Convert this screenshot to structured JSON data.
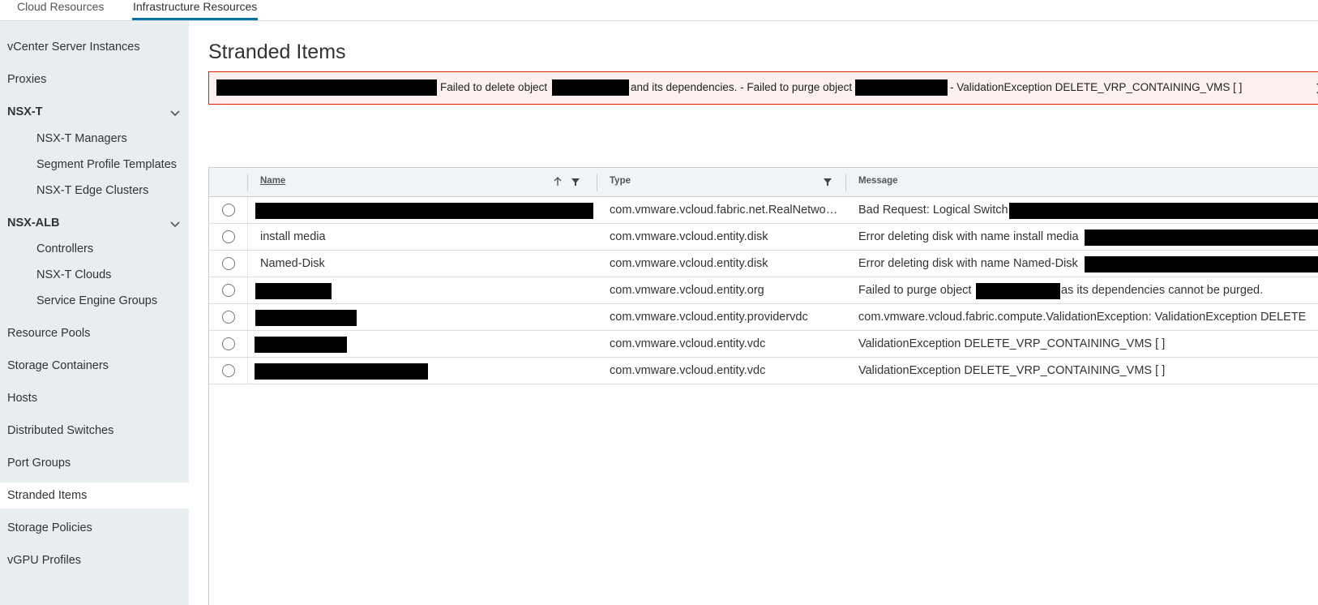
{
  "tabs": [
    {
      "label": "Cloud Resources"
    },
    {
      "label": "Infrastructure Resources"
    }
  ],
  "sidebar": {
    "items": [
      {
        "label": "vCenter Server Instances"
      },
      {
        "label": "Proxies"
      },
      {
        "label": "NSX-T"
      },
      {
        "label": "NSX-T Managers"
      },
      {
        "label": "Segment Profile Templates"
      },
      {
        "label": "NSX-T Edge Clusters"
      },
      {
        "label": "NSX-ALB"
      },
      {
        "label": "Controllers"
      },
      {
        "label": "NSX-T Clouds"
      },
      {
        "label": "Service Engine Groups"
      },
      {
        "label": "Resource Pools"
      },
      {
        "label": "Storage Containers"
      },
      {
        "label": "Hosts"
      },
      {
        "label": "Distributed Switches"
      },
      {
        "label": "Port Groups"
      },
      {
        "label": "Stranded Items"
      },
      {
        "label": "Storage Policies"
      },
      {
        "label": "vGPU Profiles"
      }
    ],
    "active": "Stranded Items"
  },
  "page": {
    "title": "Stranded Items"
  },
  "alert": {
    "part1": "Failed to delete object",
    "part2": "and its dependencies. - Failed to purge object",
    "part3": "- ValidationException DELETE_VRP_CONTAINING_VMS [ ]"
  },
  "grid": {
    "columns": {
      "name": "Name",
      "type": "Type",
      "message": "Message"
    },
    "rows": [
      {
        "name": "",
        "type": "com.vmware.vcloud.fabric.net.RealNetworkPool",
        "message": "Bad Request: Logical Switch"
      },
      {
        "name": "install media",
        "type": "com.vmware.vcloud.entity.disk",
        "message": "Error deleting disk with name install media"
      },
      {
        "name": "Named-Disk",
        "type": "com.vmware.vcloud.entity.disk",
        "message": "Error deleting disk with name Named-Disk"
      },
      {
        "name": "",
        "type": "com.vmware.vcloud.entity.org",
        "message": "Failed to purge object",
        "message_tail": "as its dependencies cannot be purged."
      },
      {
        "name": "",
        "type": "com.vmware.vcloud.entity.providervdc",
        "message": "com.vmware.vcloud.fabric.compute.ValidationException: ValidationException DELETE"
      },
      {
        "name": "",
        "type": "com.vmware.vcloud.entity.vdc",
        "message": "ValidationException DELETE_VRP_CONTAINING_VMS [ ]"
      },
      {
        "name": "",
        "type": "com.vmware.vcloud.entity.vdc",
        "message": "ValidationException DELETE_VRP_CONTAINING_VMS [ ]"
      }
    ]
  },
  "colors": {
    "accent": "#0072a3",
    "alert_border": "#e12200",
    "alert_bg": "#fdf0ef",
    "sidebar_bg": "#e8edef"
  },
  "icons": [
    "chevron-down-icon",
    "close-icon",
    "sort-ascending-icon",
    "filter-icon",
    "radio-icon"
  ]
}
